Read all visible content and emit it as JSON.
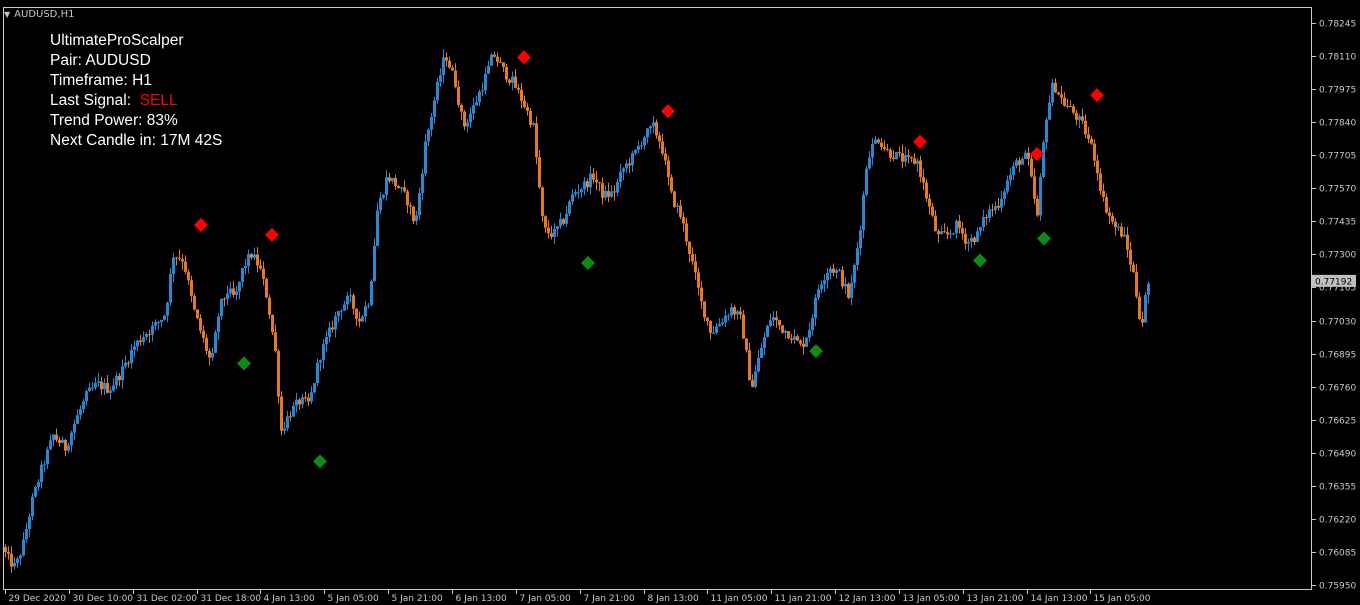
{
  "window": {
    "symbol_title": "AUDUSD,H1"
  },
  "info_panel": {
    "indicator_name": "UltimateProScalper",
    "pair_label": "Pair: AUDUSD",
    "timeframe_label": "Timeframe: H1",
    "last_signal_label": "Last Signal:  ",
    "last_signal_value": "SELL",
    "trend_power_label": "Trend Power: 83%",
    "next_candle_label": "Next Candle in: 17M 42S"
  },
  "colors": {
    "background": "#000000",
    "bull_candle": "#2f86d0",
    "bear_candle": "#e27a2c",
    "sell_signal": "#ff0000",
    "buy_signal": "#0f8a16",
    "axis": "#c8c8c8",
    "current_price_box": "#c0c0c0"
  },
  "chart_data": {
    "type": "candlestick",
    "symbol": "AUDUSD",
    "timeframe": "H1",
    "y_ticks": [
      "0.78245",
      "0.78110",
      "0.77975",
      "0.77840",
      "0.77705",
      "0.77570",
      "0.77435",
      "0.77300",
      "0.77165",
      "0.77030",
      "0.76895",
      "0.76760",
      "0.76625",
      "0.76490",
      "0.76355",
      "0.76220",
      "0.76085",
      "0.75950"
    ],
    "ylim": [
      0.7595,
      0.78245
    ],
    "current_price": "0.77192",
    "x_ticks": [
      "29 Dec 2020",
      "30 Dec 10:00",
      "31 Dec 02:00",
      "31 Dec 18:00",
      "4 Jan 13:00",
      "5 Jan 05:00",
      "5 Jan 21:00",
      "6 Jan 13:00",
      "7 Jan 05:00",
      "7 Jan 21:00",
      "8 Jan 13:00",
      "11 Jan 05:00",
      "11 Jan 21:00",
      "12 Jan 13:00",
      "13 Jan 05:00",
      "13 Jan 21:00",
      "14 Jan 13:00",
      "15 Jan 05:00"
    ],
    "close_path": [
      [
        0,
        0.7615
      ],
      [
        10,
        0.7606
      ],
      [
        18,
        0.7602
      ],
      [
        26,
        0.7612
      ],
      [
        34,
        0.7628
      ],
      [
        44,
        0.7642
      ],
      [
        56,
        0.7656
      ],
      [
        68,
        0.7651
      ],
      [
        78,
        0.7662
      ],
      [
        90,
        0.7673
      ],
      [
        100,
        0.7677
      ],
      [
        112,
        0.7675
      ],
      [
        124,
        0.7682
      ],
      [
        136,
        0.7692
      ],
      [
        146,
        0.7697
      ],
      [
        158,
        0.7701
      ],
      [
        168,
        0.7706
      ],
      [
        176,
        0.773
      ],
      [
        186,
        0.7728
      ],
      [
        196,
        0.7708
      ],
      [
        206,
        0.7695
      ],
      [
        214,
        0.7685
      ],
      [
        222,
        0.7708
      ],
      [
        230,
        0.7715
      ],
      [
        238,
        0.7712
      ],
      [
        246,
        0.7725
      ],
      [
        254,
        0.773
      ],
      [
        262,
        0.7725
      ],
      [
        270,
        0.7712
      ],
      [
        278,
        0.769
      ],
      [
        284,
        0.7658
      ],
      [
        292,
        0.7665
      ],
      [
        302,
        0.767
      ],
      [
        312,
        0.7669
      ],
      [
        322,
        0.7688
      ],
      [
        332,
        0.7698
      ],
      [
        342,
        0.7708
      ],
      [
        352,
        0.7712
      ],
      [
        362,
        0.7703
      ],
      [
        372,
        0.7712
      ],
      [
        380,
        0.7748
      ],
      [
        390,
        0.7762
      ],
      [
        400,
        0.7758
      ],
      [
        410,
        0.7752
      ],
      [
        418,
        0.7742
      ],
      [
        428,
        0.7775
      ],
      [
        438,
        0.7795
      ],
      [
        448,
        0.7812
      ],
      [
        458,
        0.78
      ],
      [
        466,
        0.7782
      ],
      [
        476,
        0.779
      ],
      [
        486,
        0.78
      ],
      [
        496,
        0.7812
      ],
      [
        506,
        0.7805
      ],
      [
        516,
        0.78
      ],
      [
        526,
        0.7792
      ],
      [
        536,
        0.7782
      ],
      [
        546,
        0.774
      ],
      [
        556,
        0.7738
      ],
      [
        566,
        0.7744
      ],
      [
        576,
        0.7755
      ],
      [
        586,
        0.7758
      ],
      [
        596,
        0.7762
      ],
      [
        606,
        0.7754
      ],
      [
        616,
        0.7755
      ],
      [
        626,
        0.7765
      ],
      [
        636,
        0.777
      ],
      [
        646,
        0.7778
      ],
      [
        656,
        0.7782
      ],
      [
        664,
        0.7775
      ],
      [
        674,
        0.7754
      ],
      [
        684,
        0.7745
      ],
      [
        694,
        0.7728
      ],
      [
        704,
        0.771
      ],
      [
        714,
        0.7698
      ],
      [
        724,
        0.7703
      ],
      [
        734,
        0.7708
      ],
      [
        744,
        0.7703
      ],
      [
        754,
        0.7675
      ],
      [
        764,
        0.7692
      ],
      [
        774,
        0.7705
      ],
      [
        784,
        0.77
      ],
      [
        794,
        0.7697
      ],
      [
        804,
        0.7692
      ],
      [
        812,
        0.77
      ],
      [
        822,
        0.7718
      ],
      [
        832,
        0.7725
      ],
      [
        842,
        0.7722
      ],
      [
        852,
        0.7712
      ],
      [
        862,
        0.7738
      ],
      [
        870,
        0.777
      ],
      [
        880,
        0.7778
      ],
      [
        890,
        0.7772
      ],
      [
        900,
        0.777
      ],
      [
        910,
        0.7768
      ],
      [
        920,
        0.7768
      ],
      [
        930,
        0.7752
      ],
      [
        940,
        0.7737
      ],
      [
        950,
        0.7738
      ],
      [
        960,
        0.7742
      ],
      [
        970,
        0.7735
      ],
      [
        980,
        0.7738
      ],
      [
        990,
        0.7747
      ],
      [
        1000,
        0.775
      ],
      [
        1010,
        0.776
      ],
      [
        1020,
        0.7768
      ],
      [
        1030,
        0.777
      ],
      [
        1040,
        0.7745
      ],
      [
        1048,
        0.7785
      ],
      [
        1056,
        0.78
      ],
      [
        1066,
        0.7792
      ],
      [
        1076,
        0.7788
      ],
      [
        1086,
        0.7782
      ],
      [
        1096,
        0.7772
      ],
      [
        1106,
        0.7752
      ],
      [
        1116,
        0.7742
      ],
      [
        1126,
        0.7738
      ],
      [
        1136,
        0.7722
      ],
      [
        1144,
        0.77
      ],
      [
        1150,
        0.7718
      ]
    ],
    "sell_signals": [
      [
        201,
        0.7742
      ],
      [
        272,
        0.7738
      ],
      [
        524,
        0.78105
      ],
      [
        668,
        0.77885
      ],
      [
        920,
        0.7776
      ],
      [
        1037,
        0.7771
      ],
      [
        1097,
        0.7795
      ]
    ],
    "buy_signals": [
      [
        244,
        0.76855
      ],
      [
        320,
        0.76455
      ],
      [
        588,
        0.77265
      ],
      [
        816,
        0.76905
      ],
      [
        980,
        0.77275
      ],
      [
        1044,
        0.77365
      ]
    ]
  }
}
